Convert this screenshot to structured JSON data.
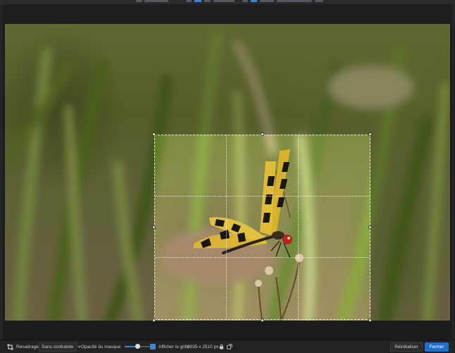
{
  "toolbar": {
    "label": "Recadrage",
    "constraint_value": "Sans contrainte",
    "mask_opacity_label": "Opacité du masque",
    "mask_opacity_value": 0.5,
    "show_grid_label": "Afficher la grille",
    "show_grid_checked": true,
    "dimensions": "2935 x 2510 px",
    "reset_label": "Réinitialiser",
    "close_label": "Fermer"
  },
  "icons": {
    "crop": "crop-icon",
    "dropdown": "chevron-down-icon",
    "lock": "lock-icon",
    "swap": "swap-icon"
  },
  "colors": {
    "accent": "#1f6fd0",
    "background": "#1c1c1e"
  }
}
